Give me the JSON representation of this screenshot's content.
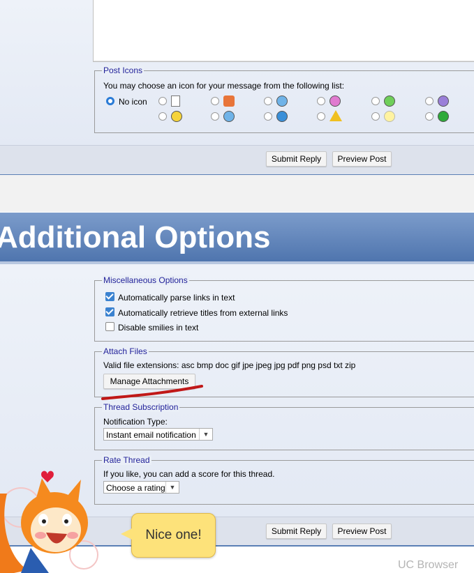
{
  "post_icons": {
    "legend": "Post Icons",
    "prompt": "You may choose an icon for your message from the following list:",
    "no_icon_label": "No icon",
    "icons_row1": [
      "document-icon",
      "thumbs-down-icon",
      "smile-blue-icon",
      "tongue-icon",
      "grin-icon",
      "angry-icon"
    ],
    "icons_row2": [
      "smile-icon",
      "cool-icon",
      "question-icon",
      "warning-icon",
      "lightbulb-icon",
      "arrow-right-icon"
    ]
  },
  "top_actions": {
    "submit_label": "Submit Reply",
    "preview_label": "Preview Post"
  },
  "section_title": "Additional Options",
  "misc": {
    "legend": "Miscellaneous Options",
    "options": [
      {
        "label": "Automatically parse links in text",
        "checked": true
      },
      {
        "label": "Automatically retrieve titles from external links",
        "checked": true
      },
      {
        "label": "Disable smilies in text",
        "checked": false
      }
    ]
  },
  "attach": {
    "legend": "Attach Files",
    "extensions": "Valid file extensions: asc bmp doc gif jpe jpeg jpg pdf png psd txt zip",
    "manage_label": "Manage Attachments"
  },
  "subscription": {
    "legend": "Thread Subscription",
    "label": "Notification Type:",
    "selected": "Instant email notification"
  },
  "rate": {
    "legend": "Rate Thread",
    "label": "If you like, you can add a score for this thread.",
    "selected": "Choose a rating"
  },
  "bottom_actions": {
    "submit_label": "Submit Reply",
    "preview_label": "Preview Post"
  },
  "mascot": {
    "bubble_text": "Nice one!"
  },
  "watermark": "UC Browser",
  "colors": {
    "title_bar": "#5a7fb5",
    "legend": "#22229a",
    "accent": "#2a7bd6",
    "bubble": "#fde27a"
  }
}
